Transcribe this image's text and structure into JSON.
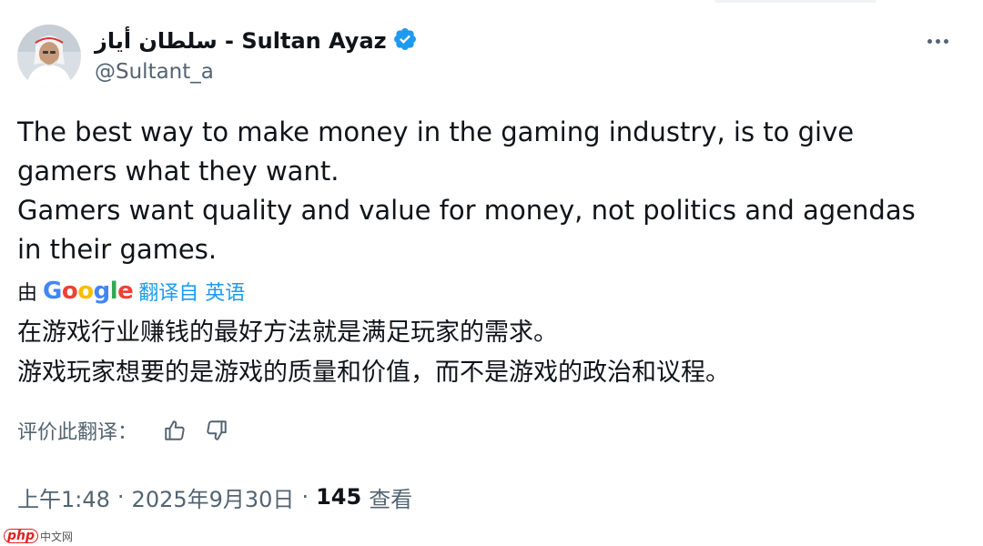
{
  "author": {
    "display_name": "سلطان أياز - Sultan Ayaz",
    "handle": "@Sultant_a",
    "verified": true
  },
  "icons": {
    "avatar": "avatar",
    "verified": "verified-badge-icon",
    "more": "more-options-icon",
    "thumbs_up": "thumbs-up-icon",
    "thumbs_down": "thumbs-down-icon"
  },
  "tweet": {
    "lines": [
      "The best way to make money in the gaming industry, is to give gamers what they want.",
      "Gamers want quality and value for money, not politics and agendas in their games."
    ]
  },
  "translation": {
    "by_label": "由",
    "logo_text": "Google",
    "link_label": "翻译自 英语",
    "lines": [
      "在游戏行业赚钱的最好方法就是满足玩家的需求。",
      "游戏玩家想要的是游戏的质量和价值，而不是游戏的政治和议程。"
    ],
    "rate_label": "评价此翻译："
  },
  "meta": {
    "time": "上午1:48",
    "separator": "·",
    "date": "2025年9月30日",
    "views_count": "145",
    "views_label": "查看"
  },
  "watermark": {
    "brand": "php",
    "site": "中文网"
  },
  "colors": {
    "accent": "#1d9bf0",
    "text_primary": "#0f1419",
    "text_secondary": "#536471"
  }
}
